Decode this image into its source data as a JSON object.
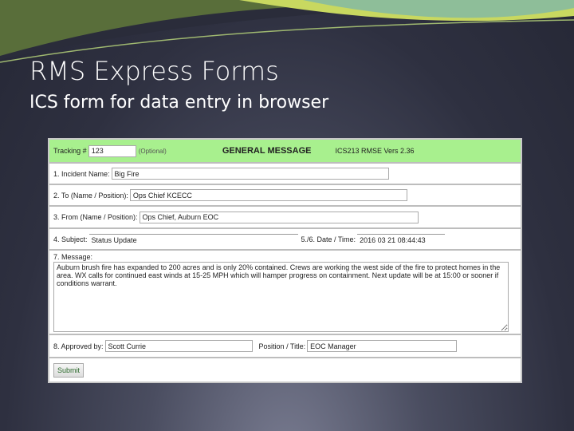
{
  "slide": {
    "title": "RMS Express Forms",
    "subtitle": "ICS form for data entry in browser"
  },
  "form": {
    "tracking_label": "Tracking #",
    "tracking_value": "123",
    "optional": "(Optional)",
    "heading": "GENERAL MESSAGE",
    "version": "ICS213 RMSE Vers 2.36",
    "incident_label": "1. Incident Name:",
    "incident_value": "Big Fire",
    "to_label": "2. To (Name / Position):",
    "to_value": "Ops Chief KCECC",
    "from_label": "3. From (Name / Position):",
    "from_value": "Ops Chief, Auburn EOC",
    "subject_label": "4. Subject:",
    "subject_value": "Status Update",
    "datetime_label": "5./6. Date / Time:",
    "datetime_value": "2016 03 21 08:44:43",
    "message_label": "7. Message:",
    "message_value": "Auburn brush fire has expanded to 200 acres and is only 20% contained. Crews are working the west side of the fire to protect homes in the area. WX calls for continued east winds at 15-25 MPH which will hamper progress on containment. Next update will be at 15:00 or sooner if conditions warrant.",
    "approved_label": "8. Approved by:",
    "approved_value": "Scott Currie",
    "position_label": "Position / Title:",
    "position_value": "EOC Manager",
    "submit": "Submit"
  }
}
